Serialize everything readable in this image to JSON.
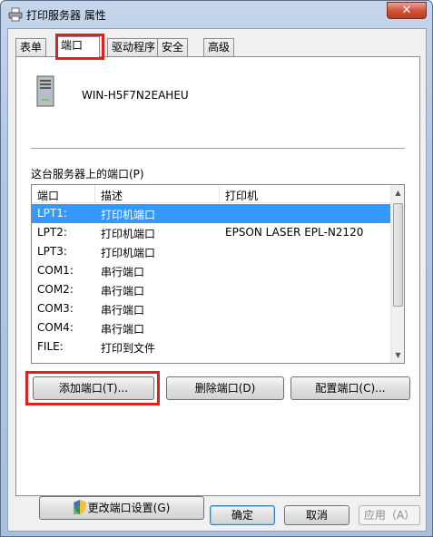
{
  "window": {
    "title": "打印服务器 属性",
    "close_label": "✕"
  },
  "tabs": [
    {
      "label": "表单"
    },
    {
      "label": "端口"
    },
    {
      "label": "驱动程序"
    },
    {
      "label": "安全"
    },
    {
      "label": "高级"
    }
  ],
  "server": {
    "name": "WIN-H5F7N2EAHEU"
  },
  "ports": {
    "label": "这台服务器上的端口(P)",
    "columns": [
      "端口",
      "描述",
      "打印机"
    ],
    "rows": [
      {
        "port": "LPT1:",
        "desc": "打印机端口",
        "printer": "",
        "selected": true
      },
      {
        "port": "LPT2:",
        "desc": "打印机端口",
        "printer": "EPSON LASER EPL-N2120"
      },
      {
        "port": "LPT3:",
        "desc": "打印机端口",
        "printer": ""
      },
      {
        "port": "COM1:",
        "desc": "串行端口",
        "printer": ""
      },
      {
        "port": "COM2:",
        "desc": "串行端口",
        "printer": ""
      },
      {
        "port": "COM3:",
        "desc": "串行端口",
        "printer": ""
      },
      {
        "port": "COM4:",
        "desc": "串行端口",
        "printer": ""
      },
      {
        "port": "FILE:",
        "desc": "打印到文件",
        "printer": ""
      }
    ]
  },
  "buttons": {
    "add_port": "添加端口(T)...",
    "delete_port": "删除端口(D)",
    "configure_port": "配置端口(C)...",
    "change_settings": "更改端口设置(G)",
    "ok": "确定",
    "cancel": "取消",
    "apply": "应用（A）"
  },
  "colors": {
    "selection": "#3399ff",
    "highlight": "#e0201b"
  }
}
